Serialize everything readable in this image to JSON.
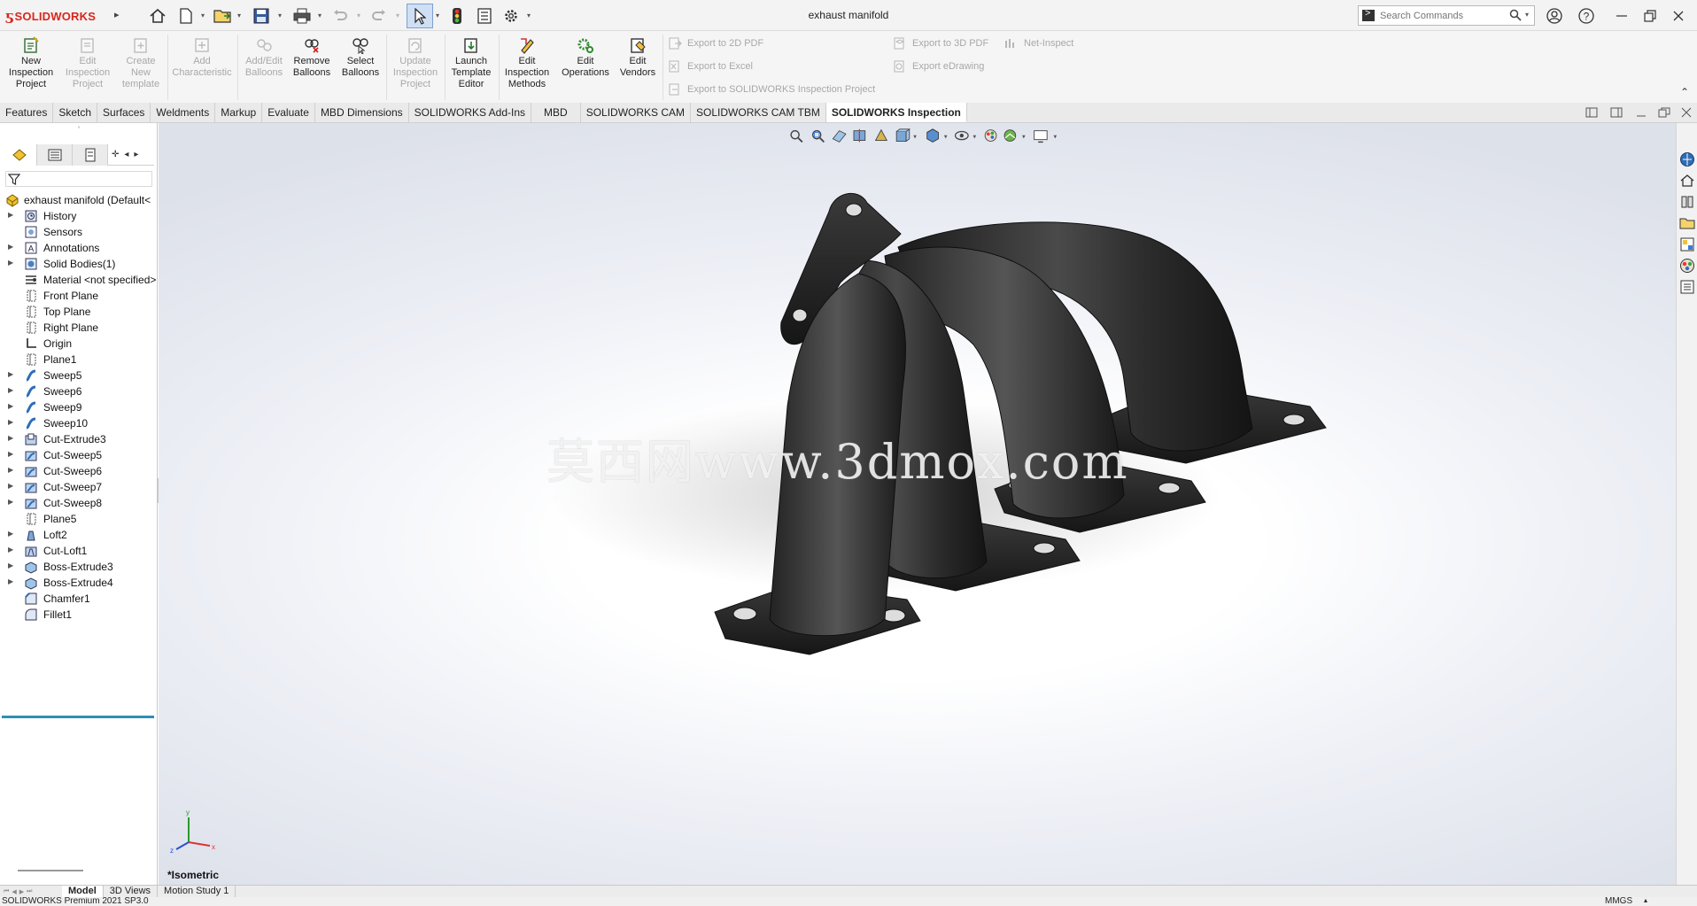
{
  "app": {
    "brand": "SOLIDWORKS",
    "window_title": "exhaust manifold"
  },
  "search": {
    "placeholder": "Search Commands"
  },
  "command_manager": {
    "buttons": [
      {
        "label": "New Inspection Project",
        "enabled": true
      },
      {
        "label": "Edit Inspection Project",
        "enabled": false
      },
      {
        "label": "Create New template",
        "enabled": false
      },
      {
        "label": "Add Characteristic",
        "enabled": false
      },
      {
        "label": "Add/Edit Balloons",
        "enabled": false
      },
      {
        "label": "Remove Balloons",
        "enabled": true
      },
      {
        "label": "Select Balloons",
        "enabled": true
      },
      {
        "label": "Update Inspection Project",
        "enabled": false
      },
      {
        "label": "Launch Template Editor",
        "enabled": true
      },
      {
        "label": "Edit Inspection Methods",
        "enabled": true
      },
      {
        "label": "Edit Operations",
        "enabled": true
      },
      {
        "label": "Edit Vendors",
        "enabled": true
      }
    ],
    "export_buttons": [
      "Export to 2D PDF",
      "Export to Excel",
      "Export to SOLIDWORKS Inspection Project",
      "Export to 3D PDF",
      "Export eDrawing",
      "Net-Inspect"
    ]
  },
  "tabs": [
    {
      "label": "Features",
      "active": false
    },
    {
      "label": "Sketch",
      "active": false
    },
    {
      "label": "Surfaces",
      "active": false
    },
    {
      "label": "Weldments",
      "active": false
    },
    {
      "label": "Markup",
      "active": false
    },
    {
      "label": "Evaluate",
      "active": false
    },
    {
      "label": "MBD Dimensions",
      "active": false
    },
    {
      "label": "SOLIDWORKS Add-Ins",
      "active": false
    },
    {
      "label": "MBD",
      "active": false
    },
    {
      "label": "SOLIDWORKS CAM",
      "active": false
    },
    {
      "label": "SOLIDWORKS CAM TBM",
      "active": false
    },
    {
      "label": "SOLIDWORKS Inspection",
      "active": true
    }
  ],
  "feature_tree": {
    "root": "exhaust manifold  (Default<",
    "items": [
      {
        "label": "History",
        "icon": "history-icon",
        "expandable": true
      },
      {
        "label": "Sensors",
        "icon": "sensors-icon",
        "expandable": false
      },
      {
        "label": "Annotations",
        "icon": "annotations-icon",
        "expandable": true
      },
      {
        "label": "Solid Bodies(1)",
        "icon": "solid-bodies-icon",
        "expandable": true
      },
      {
        "label": "Material <not specified>",
        "icon": "material-icon",
        "expandable": false
      },
      {
        "label": "Front Plane",
        "icon": "plane-icon",
        "expandable": false
      },
      {
        "label": "Top Plane",
        "icon": "plane-icon",
        "expandable": false
      },
      {
        "label": "Right Plane",
        "icon": "plane-icon",
        "expandable": false
      },
      {
        "label": "Origin",
        "icon": "origin-icon",
        "expandable": false
      },
      {
        "label": "Plane1",
        "icon": "plane-icon",
        "expandable": false
      },
      {
        "label": "Sweep5",
        "icon": "sweep-icon",
        "expandable": true
      },
      {
        "label": "Sweep6",
        "icon": "sweep-icon",
        "expandable": true
      },
      {
        "label": "Sweep9",
        "icon": "sweep-icon",
        "expandable": true
      },
      {
        "label": "Sweep10",
        "icon": "sweep-icon",
        "expandable": true
      },
      {
        "label": "Cut-Extrude3",
        "icon": "cut-extrude-icon",
        "expandable": true
      },
      {
        "label": "Cut-Sweep5",
        "icon": "cut-sweep-icon",
        "expandable": true
      },
      {
        "label": "Cut-Sweep6",
        "icon": "cut-sweep-icon",
        "expandable": true
      },
      {
        "label": "Cut-Sweep7",
        "icon": "cut-sweep-icon",
        "expandable": true
      },
      {
        "label": "Cut-Sweep8",
        "icon": "cut-sweep-icon",
        "expandable": true
      },
      {
        "label": "Plane5",
        "icon": "plane-icon",
        "expandable": false
      },
      {
        "label": "Loft2",
        "icon": "loft-icon",
        "expandable": true
      },
      {
        "label": "Cut-Loft1",
        "icon": "cut-loft-icon",
        "expandable": true
      },
      {
        "label": "Boss-Extrude3",
        "icon": "boss-extrude-icon",
        "expandable": true
      },
      {
        "label": "Boss-Extrude4",
        "icon": "boss-extrude-icon",
        "expandable": true
      },
      {
        "label": "Chamfer1",
        "icon": "chamfer-icon",
        "expandable": false
      },
      {
        "label": "Fillet1",
        "icon": "fillet-icon",
        "expandable": false
      }
    ]
  },
  "viewport": {
    "watermark": "莫西网www.3dmox.com",
    "view_name": "*Isometric",
    "triad": {
      "x": "x",
      "y": "y",
      "z": "z"
    }
  },
  "bottom_tabs": [
    {
      "label": "Model",
      "active": true
    },
    {
      "label": "3D Views",
      "active": false
    },
    {
      "label": "Motion Study 1",
      "active": false
    }
  ],
  "status": {
    "text": "SOLIDWORKS Premium 2021 SP3.0",
    "units": "MMGS"
  },
  "colors": {
    "brand_red": "#d9261c",
    "accent_blue": "#2c8fb2",
    "part_dark": "#2b2b2b"
  }
}
